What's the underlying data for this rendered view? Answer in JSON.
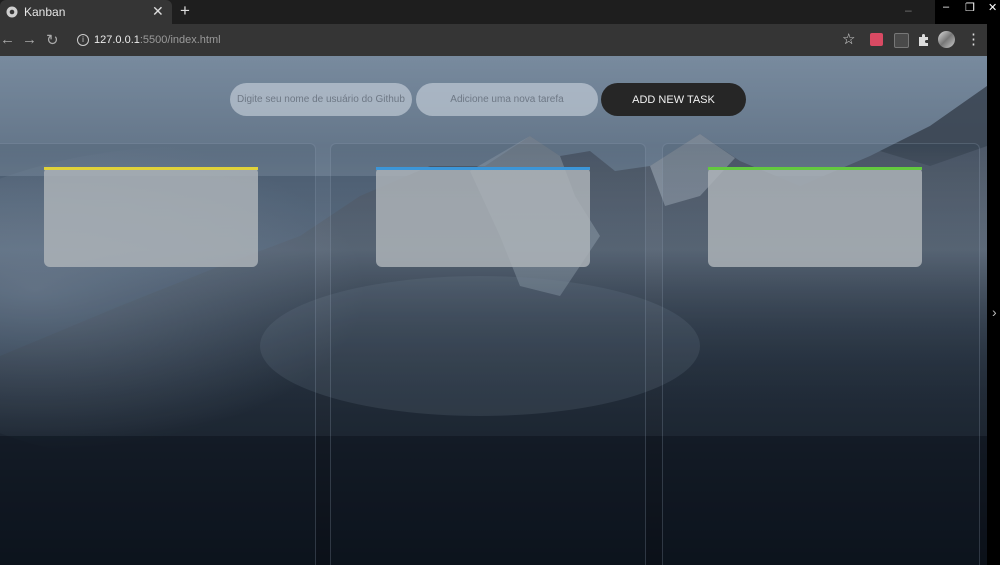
{
  "browser": {
    "tab": {
      "title": "Kanban"
    },
    "url": {
      "host": "127.0.0.1",
      "rest": ":5500/index.html"
    }
  },
  "header": {
    "github_input": {
      "placeholder": "Digite seu nome de usuário do Github",
      "value": ""
    },
    "task_input": {
      "placeholder": "Adicione uma nova tarefa",
      "value": ""
    },
    "add_button": "ADD NEW TASK"
  },
  "board": {
    "columns": [
      {
        "accent": "#e0d23a"
      },
      {
        "accent": "#3c96d8"
      },
      {
        "accent": "#63c93f"
      }
    ]
  },
  "colors": {
    "chrome_dark": "#1e1e1e",
    "chrome_bar": "#353535",
    "button_dark": "#262626"
  },
  "icons": [
    "chrome-logo-icon",
    "close-icon",
    "plus-icon",
    "back-arrow-icon",
    "forward-arrow-icon",
    "reload-icon",
    "info-icon",
    "star-icon",
    "extension-icon",
    "puzzle-icon",
    "avatar",
    "kebab-menu-icon",
    "chevron-right-icon"
  ]
}
